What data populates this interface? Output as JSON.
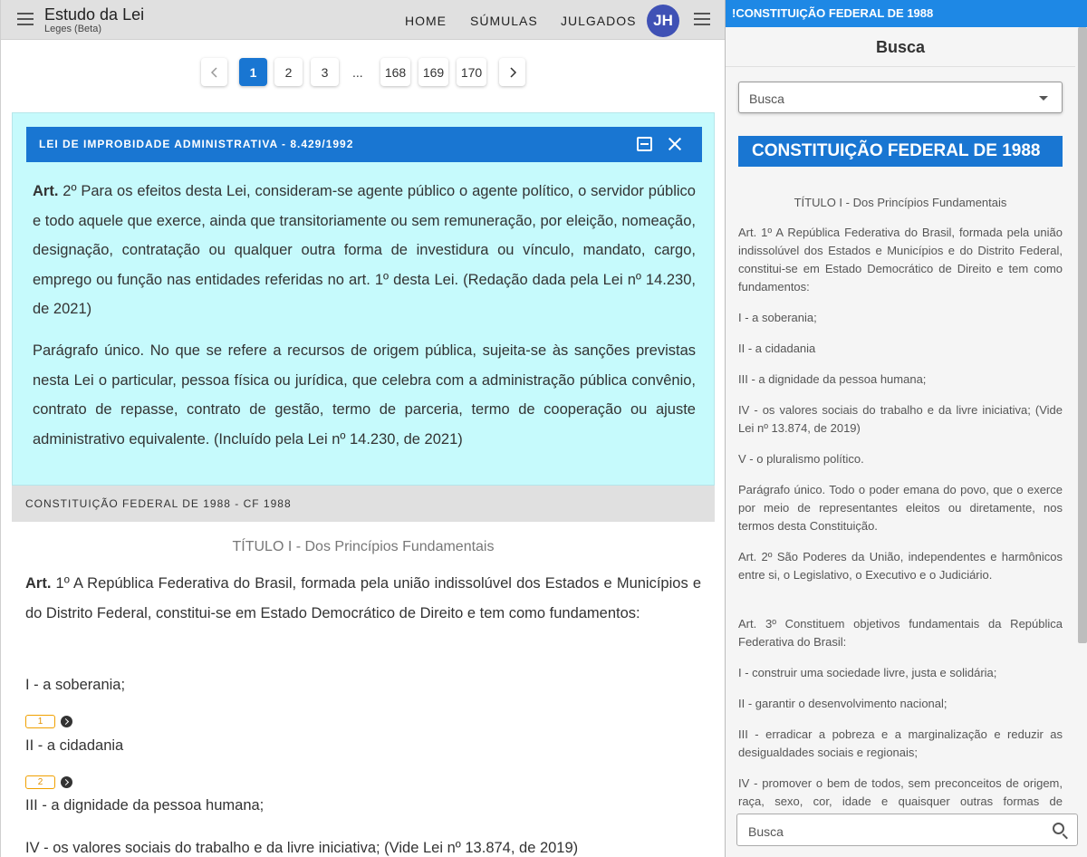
{
  "appbar": {
    "title": "Estudo da Lei",
    "subtitle": "Leges (Beta)",
    "nav": [
      "HOME",
      "SÚMULAS",
      "JULGADOS"
    ],
    "avatar_initials": "JH",
    "avatar_color": "#3f51b5"
  },
  "pagination": {
    "pages": [
      "1",
      "2",
      "3",
      "168",
      "169",
      "170"
    ],
    "ellipsis": "...",
    "current": "1"
  },
  "card1": {
    "title": "LEI DE IMPROBIDADE ADMINISTRATIVA - 8.429/1992",
    "art_label": "Art.",
    "art_text": "2º Para os efeitos desta Lei, consideram-se agente público o agente político, o servidor público e todo aquele que exerce, ainda que transitoriamente ou sem remuneração, por eleição, nomeação, designação, contratação ou qualquer outra forma de investidura ou vínculo, mandato, cargo, emprego ou função nas entidades referidas no art. 1º desta Lei. (Redação dada pela Lei nº 14.230, de 2021)",
    "paragrafo": "Parágrafo único. No que se refere a recursos de origem pública, sujeita-se às sanções previstas nesta Lei o particular, pessoa física ou jurídica, que celebra com a administração pública convênio, contrato de repasse, contrato de gestão, termo de parceria, termo de cooperação ou ajuste administrativo equivalente. (Incluído pela Lei nº 14.230, de 2021)",
    "bg_color": "#c6fafc",
    "head_color": "#1976d2"
  },
  "card2": {
    "title": "CONSTITUIÇÃO FEDERAL DE 1988 - CF 1988",
    "titulo": "TÍTULO I - Dos Princípios Fundamentais",
    "art_label": "Art.",
    "art_text": "1º A República Federativa do Brasil, formada pela união indissolúvel dos Estados e Municípios e do Distrito Federal, constitui-se em Estado Democrático de Direito e tem como fundamentos:",
    "inc1": "I - a soberania;",
    "note1": "1",
    "inc2": "II - a cidadania",
    "note2": "2",
    "inc3": "III - a dignidade da pessoa humana;",
    "inc4": "IV - os valores sociais do trabalho e da livre iniciativa; (Vide Lei nº 13.874, de 2019)"
  },
  "right": {
    "topbar": "!CONSTITUIÇÃO FEDERAL DE 1988",
    "heading": "Busca",
    "select_value": "Busca",
    "banner": "CONSTITUIÇÃO FEDERAL DE 1988",
    "titulo": "TÍTULO I - Dos Princípios Fundamentais",
    "paragraphs": [
      "Art. 1º A República Federativa do Brasil, formada pela união indissolúvel dos Estados e Municípios e do Distrito Federal, constitui-se em Estado Democrático de Direito e tem como fundamentos:",
      "I - a soberania;",
      "II - a cidadania",
      "III - a dignidade da pessoa humana;",
      "IV - os valores sociais do trabalho e da livre iniciativa; (Vide Lei nº 13.874, de 2019)",
      "V - o pluralismo político.",
      "Parágrafo único. Todo o poder emana do povo, que o exerce por meio de representantes eleitos ou diretamente, nos termos desta Constituição.",
      "Art. 2º São Poderes da União, independentes e harmônicos entre si, o Legislativo, o Executivo e o Judiciário.",
      "Art. 3º Constituem objetivos fundamentais da República Federativa do Brasil:",
      "I - construir uma sociedade livre, justa e solidária;",
      "II - garantir o desenvolvimento nacional;",
      "III - erradicar a pobreza e a marginalização e reduzir as desigualdades sociais e regionais;",
      "IV - promover o bem de todos, sem preconceitos de origem, raça, sexo, cor, idade e quaisquer outras formas de discriminação."
    ],
    "search_placeholder": "Busca",
    "accent_color": "#1e88e5"
  }
}
